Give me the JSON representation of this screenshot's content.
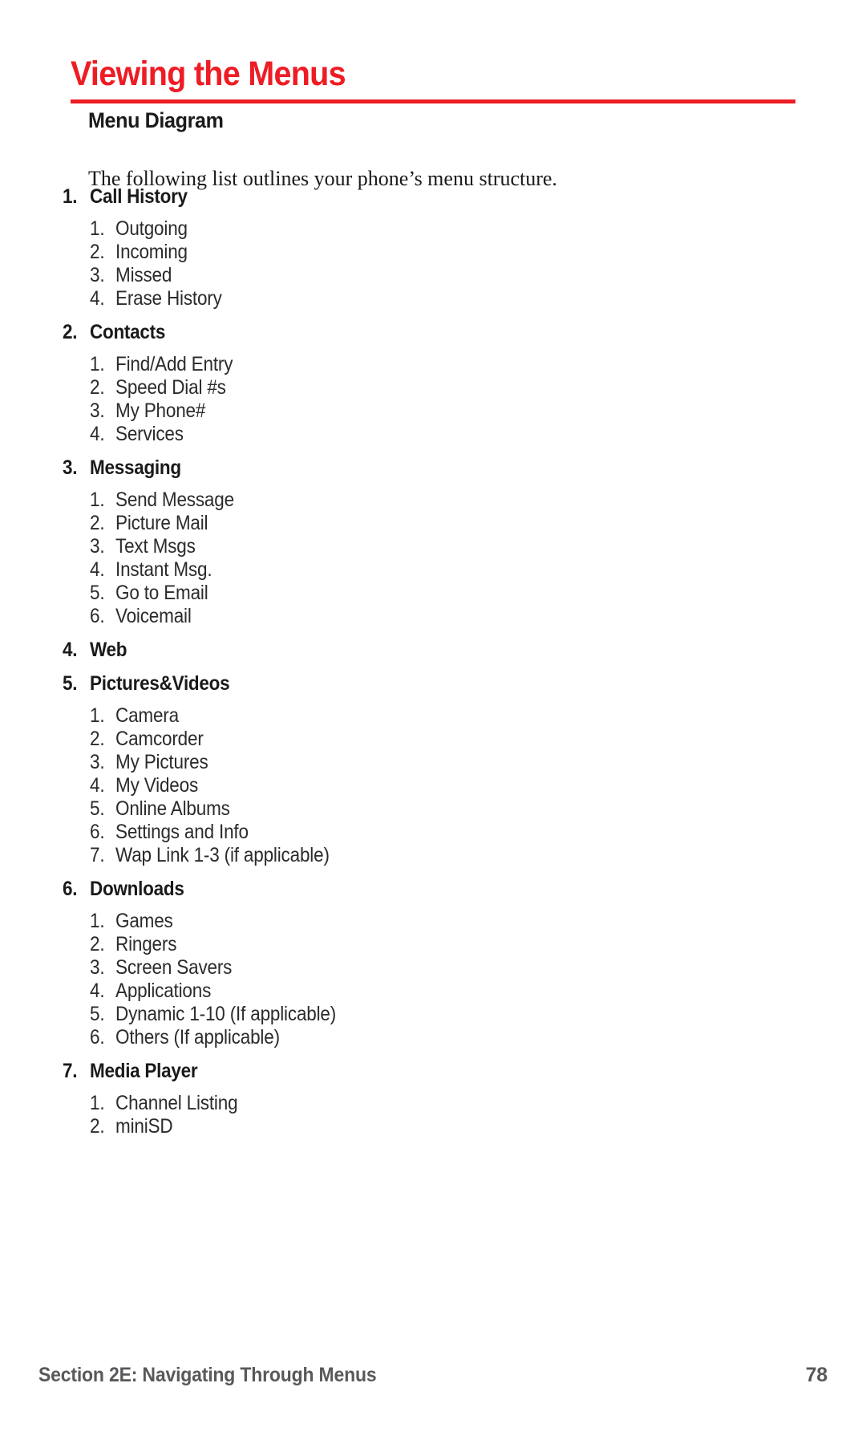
{
  "header": {
    "title": "Viewing the Menus",
    "subheading": "Menu Diagram",
    "intro": "The following list outlines your phone’s menu structure.",
    "accent_color": "#ee1c24"
  },
  "menu": {
    "sections": [
      {
        "number": "1.",
        "label": "Call History",
        "items": [
          {
            "number": "1.",
            "label": "Outgoing"
          },
          {
            "number": "2.",
            "label": "Incoming"
          },
          {
            "number": "3.",
            "label": "Missed"
          },
          {
            "number": "4.",
            "label": "Erase History"
          }
        ]
      },
      {
        "number": "2.",
        "label": "Contacts",
        "items": [
          {
            "number": "1.",
            "label": "Find/Add Entry"
          },
          {
            "number": "2.",
            "label": "Speed Dial #s"
          },
          {
            "number": "3.",
            "label": "My Phone#"
          },
          {
            "number": "4.",
            "label": "Services"
          }
        ]
      },
      {
        "number": "3.",
        "label": "Messaging",
        "items": [
          {
            "number": "1.",
            "label": "Send Message"
          },
          {
            "number": "2.",
            "label": "Picture Mail"
          },
          {
            "number": "3.",
            "label": "Text Msgs"
          },
          {
            "number": "4.",
            "label": "Instant Msg."
          },
          {
            "number": "5.",
            "label": "Go to Email"
          },
          {
            "number": "6.",
            "label": "Voicemail"
          }
        ]
      },
      {
        "number": "4.",
        "label": "Web",
        "items": []
      },
      {
        "number": "5.",
        "label": "Pictures&Videos",
        "items": [
          {
            "number": "1.",
            "label": "Camera"
          },
          {
            "number": "2.",
            "label": "Camcorder"
          },
          {
            "number": "3.",
            "label": "My Pictures"
          },
          {
            "number": "4.",
            "label": "My Videos"
          },
          {
            "number": "5.",
            "label": "Online Albums"
          },
          {
            "number": "6.",
            "label": "Settings and Info"
          },
          {
            "number": "7.",
            "label": "Wap Link 1-3 (if applicable)"
          }
        ]
      },
      {
        "number": "6.",
        "label": "Downloads",
        "items": [
          {
            "number": "1.",
            "label": "Games"
          },
          {
            "number": "2.",
            "label": "Ringers"
          },
          {
            "number": "3.",
            "label": "Screen Savers"
          },
          {
            "number": "4.",
            "label": "Applications"
          },
          {
            "number": "5.",
            "label": "Dynamic 1-10 (If applicable)"
          },
          {
            "number": "6.",
            "label": "Others (If applicable)"
          }
        ]
      },
      {
        "number": "7.",
        "label": "Media Player",
        "items": [
          {
            "number": "1.",
            "label": "Channel Listing"
          },
          {
            "number": "2.",
            "label": "miniSD"
          }
        ]
      }
    ]
  },
  "footer": {
    "section_label": "Section 2E: Navigating Through Menus",
    "page_number": "78"
  }
}
